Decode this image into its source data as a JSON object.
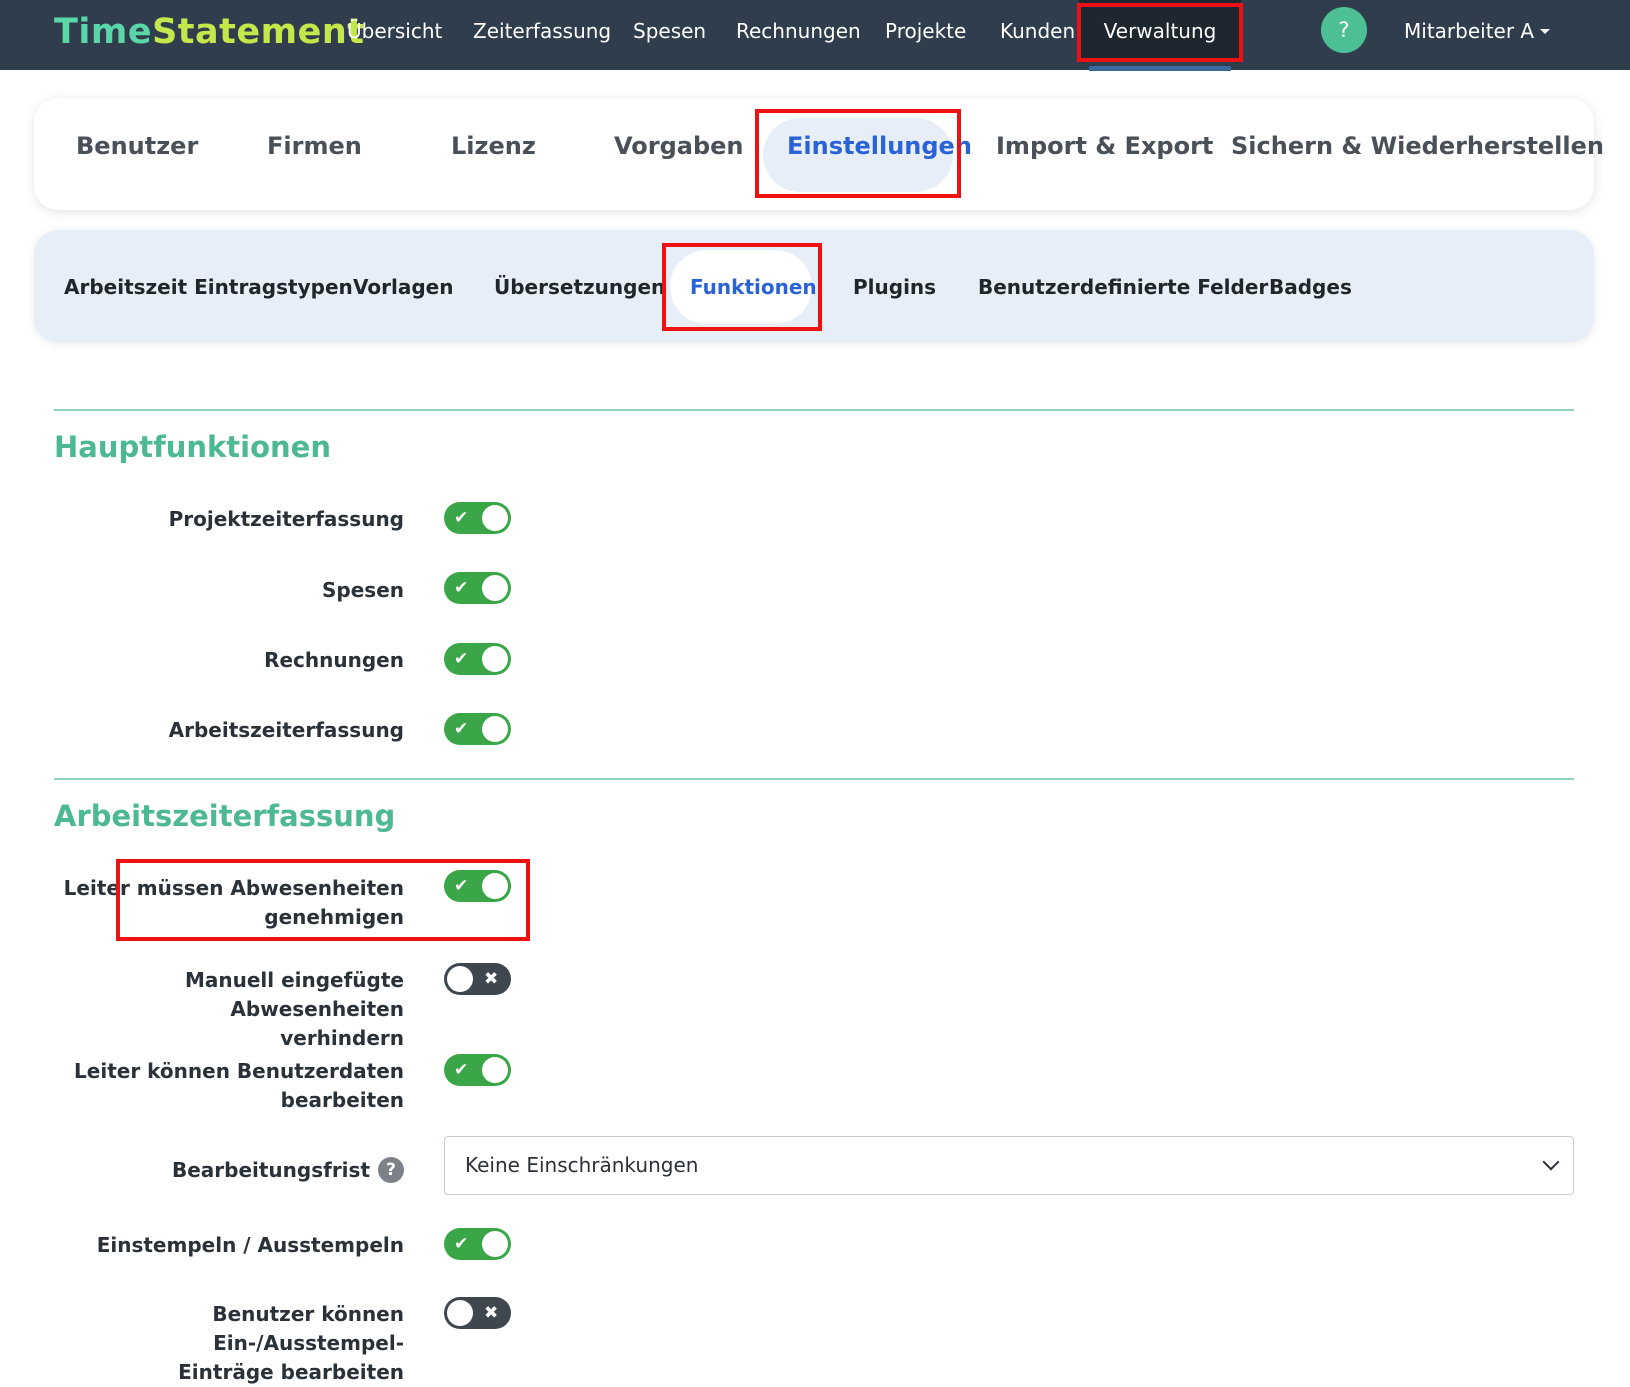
{
  "navbar": {
    "brand_part1": "Time",
    "brand_part2": "Statement",
    "items": [
      {
        "label": "Übersicht"
      },
      {
        "label": "Zeiterfassung"
      },
      {
        "label": "Spesen"
      },
      {
        "label": "Rechnungen"
      },
      {
        "label": "Projekte"
      },
      {
        "label": "Kunden"
      },
      {
        "label": "Verwaltung",
        "active": true
      }
    ],
    "help_label": "?",
    "user_label": "Mitarbeiter A"
  },
  "tabs": [
    {
      "label": "Benutzer"
    },
    {
      "label": "Firmen"
    },
    {
      "label": "Lizenz"
    },
    {
      "label": "Vorgaben"
    },
    {
      "label": "Einstellungen",
      "active": true
    },
    {
      "label": "Import & Export"
    },
    {
      "label": "Sichern & Wiederherstellen"
    }
  ],
  "subtabs": [
    {
      "label": "Arbeitszeit Eintragstypen"
    },
    {
      "label": "Vorlagen"
    },
    {
      "label": "Übersetzungen"
    },
    {
      "label": "Funktionen",
      "active": true
    },
    {
      "label": "Plugins"
    },
    {
      "label": "Benutzerdefinierte Felder"
    },
    {
      "label": "Badges"
    }
  ],
  "sections": {
    "main": {
      "title": "Hauptfunktionen",
      "rows": [
        {
          "label": "Projektzeiterfassung",
          "enabled": true
        },
        {
          "label": "Spesen",
          "enabled": true
        },
        {
          "label": "Rechnungen",
          "enabled": true
        },
        {
          "label": "Arbeitszeiterfassung",
          "enabled": true
        }
      ]
    },
    "worktime": {
      "title": "Arbeitszeiterfassung",
      "rows": [
        {
          "label_line1": "Leiter müssen Abwesenheiten",
          "label_line2": "genehmigen",
          "enabled": true
        },
        {
          "label_line1": "Manuell eingefügte Abwesenheiten",
          "label_line2": "verhindern",
          "enabled": false
        },
        {
          "label_line1": "Leiter können Benutzerdaten",
          "label_line2": "bearbeiten",
          "enabled": true
        },
        {
          "label": "Einstempeln / Ausstempeln",
          "enabled": true
        },
        {
          "label_line1": "Benutzer können Ein-/Ausstempel-",
          "label_line2": "Einträge bearbeiten",
          "enabled": false
        }
      ],
      "edit_deadline": {
        "label": "Bearbeitungsfrist",
        "help": "?",
        "selected": "Keine Einschränkungen"
      }
    }
  },
  "toggle_glyphs": {
    "on": "✔",
    "off": "✖"
  },
  "colors": {
    "navbar_bg": "#2f3d4c",
    "brand_time": "#5bd6a8",
    "brand_statement": "#c4e84c",
    "accent_blue": "#2a63d6",
    "section_green": "#4cb894",
    "toggle_on": "#3aa648",
    "toggle_off": "#3f464d",
    "highlight_red": "#ee1111"
  }
}
